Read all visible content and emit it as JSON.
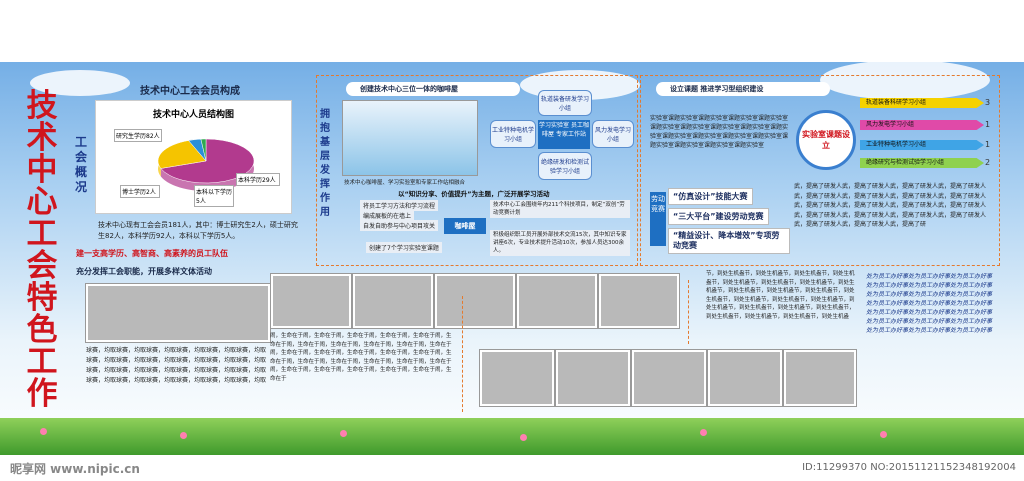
{
  "title_vertical": "技术中心工会特色工作",
  "subtitle_vertical": "工会概况",
  "member_section": {
    "heading": "技术中心工会会员构成",
    "chart_title": "技术中心人员结构图",
    "chart_data": {
      "type": "pie",
      "categories": [
        "研究生学历82人",
        "本科学历29人",
        "本科以下学历5人",
        "博士学历2人"
      ],
      "values": [
        82,
        29,
        5,
        2
      ],
      "colors": [
        "#b23a8e",
        "#f5c400",
        "#2b8fd9",
        "#2fa84f"
      ]
    },
    "paragraph": "技术中心现有工会会员181人，其中：博士研究生2人，硕士研究生82人，本科学历92人，本科以下学历5人。",
    "slogan": "建一支高学历、高智商、高素养的员工队伍"
  },
  "activity_section": {
    "heading": "充分发挥工会职能，开展多样文体活动",
    "filler": "球赛，均取球赛，均取球赛，均取球赛，均取球赛，均取球赛，均取球赛，均取球赛，均取球赛，均取球赛，均取球赛，均取球赛，均取球赛，均取球赛，均取球赛，均取球赛，均取球赛，均取球赛，均取球赛，均取球赛，均取球赛，均取球赛，均取球赛，均取球赛，均取"
  },
  "coffee_section": {
    "side_label": "拥抱基层发挥作用",
    "heading": "创建技术中心三位一体的咖啡屋",
    "photo_caption": "技术中心咖啡屋、学习实验室和专家工作站相融合",
    "center": "学习实验室 员工咖啡屋 专家工作站",
    "nodes": [
      "轨道装备研发学习小组",
      "风力发电学习小组",
      "绝缘研发和检测试验学习小组",
      "工业特种电机学习小组"
    ],
    "motto": "以“知识分享、价值提升”为主题，广泛开展学习活动",
    "bullets": [
      "将员工学习方法和学习流程",
      "编成展板的在墙上",
      "自发自助参与中心项目攻关"
    ],
    "bullet_last": "创建了7个学习实验室课题",
    "badge": "咖啡屋",
    "notes": [
      "技术中心工会围绕年内211个科技项目，制定“双创”劳动竞赛计划",
      "积极组织职工员开展外部技术交流15次，其中知识专家讲座6次，专业技术提升活动10次，参加人员达300余人。"
    ]
  },
  "lab_section": {
    "heading": "设立课题 推进学习型组织建设",
    "lab_text": "实验室课题实验室课题实验室课题实验室课题实验室课题实验室课题实验室课题实验室课题实验室课题实验室课题实验室课题实验室课题实验室课题实验室课题实验室课题实验室课题实验室课题实验室",
    "circle": "实验室课题设立",
    "groups": [
      {
        "name": "轨道装备科研学习小组",
        "count": "3",
        "color": "#f5d200"
      },
      {
        "name": "风力发电学习小组",
        "count": "1",
        "color": "#e04aa8"
      },
      {
        "name": "工业特种电机学习小组",
        "count": "1",
        "color": "#3fa4e6"
      },
      {
        "name": "绝缘研究与检测试验学习小组",
        "count": "2",
        "color": "#8fd14f"
      }
    ]
  },
  "competition": {
    "label": "劳动竞赛",
    "items": [
      "“仿真设计”技能大赛",
      "“三大平台”建设劳动竞赛",
      "“精益设计、降本增效”专项劳动竞赛"
    ],
    "filler": "武，提高了研发人武，提高了研发人武，提高了研发人武，提高了研发人武，提高了研发人武，提高了研发人武，提高了研发人武，提高了研发人武，提高了研发人武，提高了研发人武，提高了研发人武，提高了研发人武，提高了研发人武，提高了研发人武，提高了研发人武，提高了研发人武，提高了研发人武，提高了研发人武，提高了研"
  },
  "bottom_texts": {
    "left": "闹，生命在于闹，生命在于闹，生命在于闹，生命在于闹，生命在于闹，生命在于闹，生命在于闹，生命在于闹，生命在于闹，生命在于闹，生命在于闹，生命在于闹，生命在于闹，生命在于闹，生命在于闹，生命在于闹，生命在于闹，生命在于闹，生命在于闹，生命在于闹，生命在于闹，生命在于闹，生命在于闹，生命在于闹，生命在于闹，生命在于闹，生命在于闹，生命在于",
    "middle": "节，到处生机盎节，到处生机盎节，到处生机盎节，到处生机盎节，到处生机盎节，到处生机盎节，到处生机盎节，到处生机盎节，到处生机盎节，到处生机盎节，到处生机盎节，到处生机盎节，到处生机盎节，到处生机盎节，到处生机盎节，到处生机盎节，到处生机盎节，到处生机盎节，到处生机盎节，到处生机盎节，到处生机盎节，到处生机盎节，到处生机盎",
    "right": "处为员工办好事处为员工办好事处为员工办好事处为员工办好事处为员工办好事处为员工办好事处为员工办好事处为员工办好事处为员工办好事处为员工办好事处为员工办好事处为员工办好事处为员工办好事处为员工办好事处为员工办好事处为员工办好事处为员工办好事处为员工办好事处为员工办好事处为员工办好事处为员工办好事"
  },
  "footer": {
    "watermark": "昵享网 www.nipic.cn",
    "id": "ID:11299370 NO:20151121152348192004"
  }
}
